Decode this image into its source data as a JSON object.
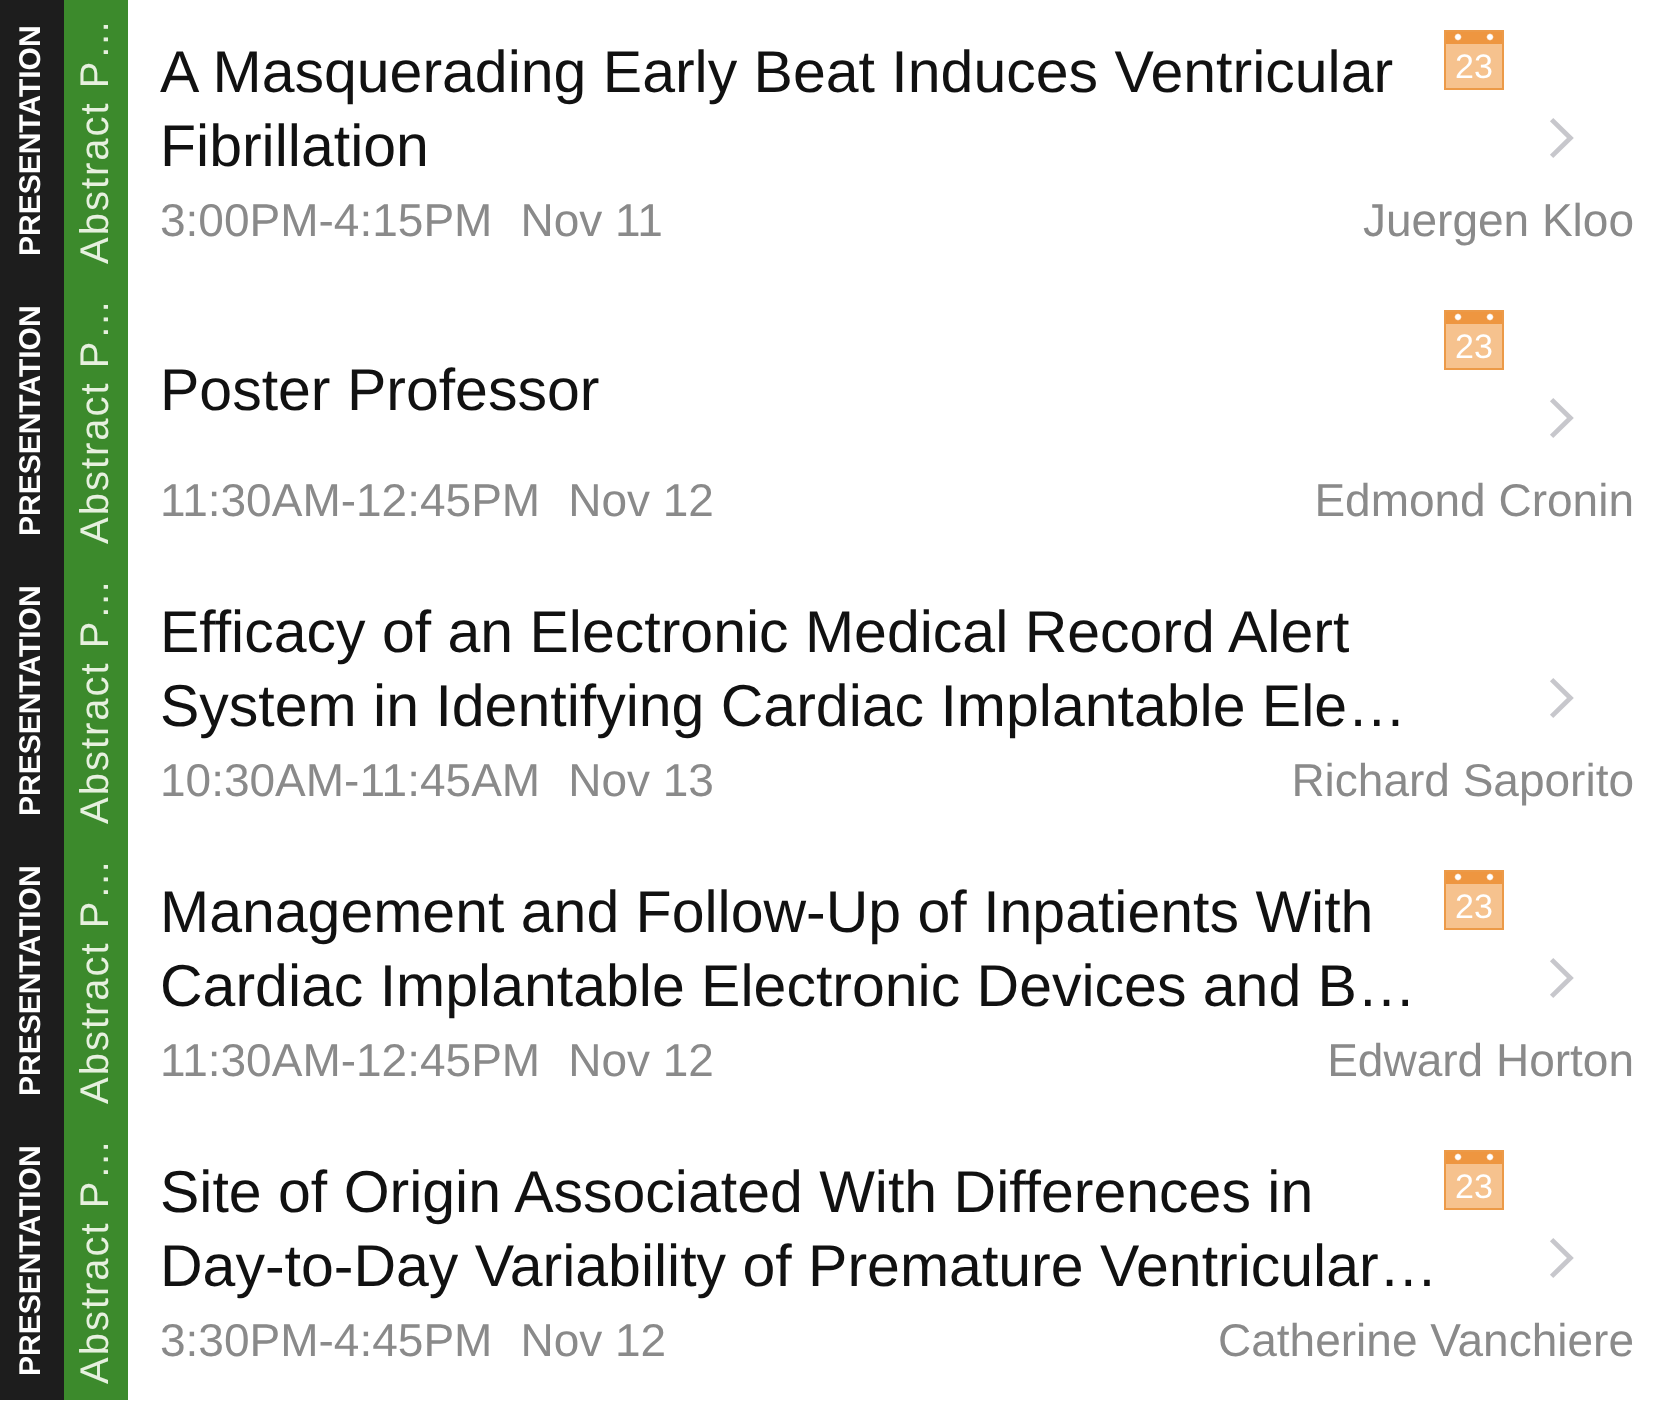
{
  "sessions": [
    {
      "type_label": "PRESENTATION",
      "category_label": "Abstract P…",
      "title_lines": [
        "A Masquerading Early Beat Induces Ventricular",
        "Fibrillation"
      ],
      "calendar_day": "23",
      "time": "3:00PM-4:15PM",
      "date": "Nov 11",
      "speaker": "Juergen Kloo"
    },
    {
      "type_label": "PRESENTATION",
      "category_label": "Abstract P…",
      "title_lines": [
        "Poster Professor"
      ],
      "calendar_day": "23",
      "time": "11:30AM-12:45PM",
      "date": "Nov 12",
      "speaker": "Edmond Cronin"
    },
    {
      "type_label": "PRESENTATION",
      "category_label": "Abstract P…",
      "title_lines": [
        "Efficacy of an Electronic Medical Record Alert",
        "System in Identifying Cardiac Implantable Ele…"
      ],
      "time": "10:30AM-11:45AM",
      "date": "Nov 13",
      "speaker": "Richard Saporito"
    },
    {
      "type_label": "PRESENTATION",
      "category_label": "Abstract P…",
      "title_lines": [
        "Management and Follow-Up of Inpatients With",
        "Cardiac Implantable Electronic Devices and B…"
      ],
      "calendar_day": "23",
      "time": "11:30AM-12:45PM",
      "date": "Nov 12",
      "speaker": "Edward Horton"
    },
    {
      "type_label": "PRESENTATION",
      "category_label": "Abstract P…",
      "title_lines": [
        "Site of Origin Associated With Differences in",
        "Day-to-Day Variability of Premature Ventricular…"
      ],
      "calendar_day": "23",
      "time": "3:30PM-4:45PM",
      "date": "Nov 12",
      "speaker": "Catherine Vanchiere"
    }
  ]
}
